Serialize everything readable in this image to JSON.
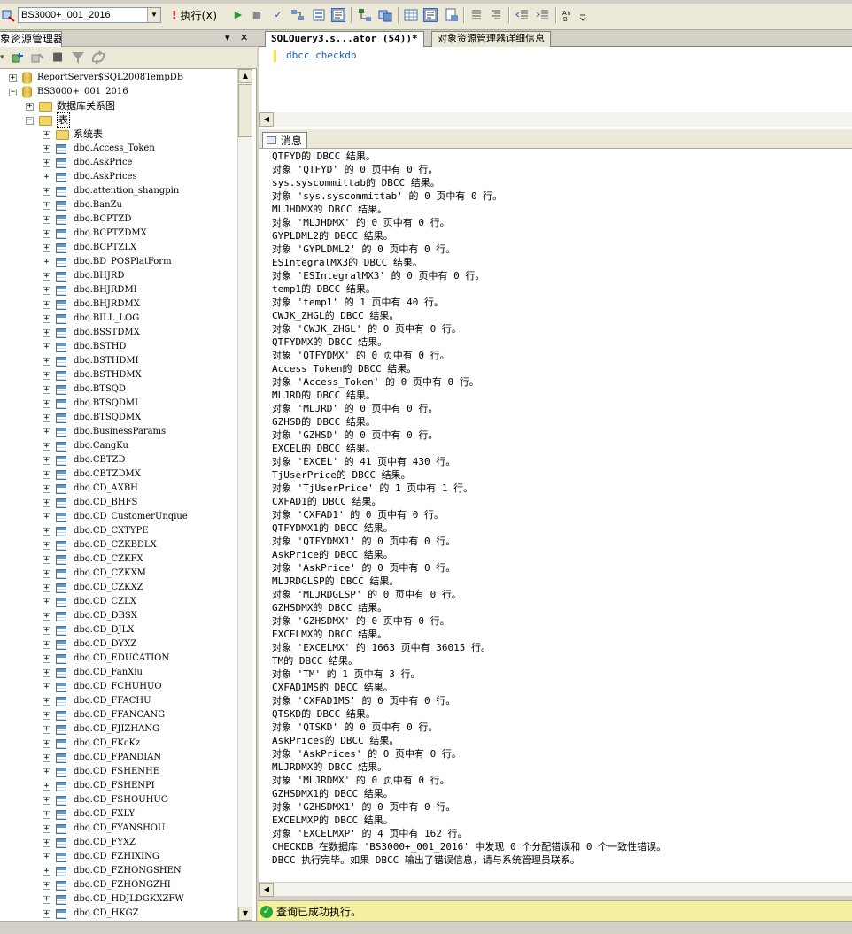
{
  "toolbar": {
    "database": "BS3000+_001_2016",
    "execute_label": "执行(X)"
  },
  "object_explorer": {
    "title": "象资源管理器",
    "pin": "▾",
    "close": "✕",
    "tree": {
      "server_db": "ReportServer$SQL2008TempDB",
      "db": "BS3000+_001_2016",
      "diagrams": "数据库关系图",
      "tables": "表",
      "system_tables": "系统表",
      "table_items": [
        "dbo.Access_Token",
        "dbo.AskPrice",
        "dbo.AskPrices",
        "dbo.attention_shangpin",
        "dbo.BanZu",
        "dbo.BCPTZD",
        "dbo.BCPTZDMX",
        "dbo.BCPTZLX",
        "dbo.BD_POSPlatForm",
        "dbo.BHJRD",
        "dbo.BHJRDMI",
        "dbo.BHJRDMX",
        "dbo.BILL_LOG",
        "dbo.BSSTDMX",
        "dbo.BSTHD",
        "dbo.BSTHDMI",
        "dbo.BSTHDMX",
        "dbo.BTSQD",
        "dbo.BTSQDMI",
        "dbo.BTSQDMX",
        "dbo.BusinessParams",
        "dbo.CangKu",
        "dbo.CBTZD",
        "dbo.CBTZDMX",
        "dbo.CD_AXBH",
        "dbo.CD_BHFS",
        "dbo.CD_CustomerUnqiue",
        "dbo.CD_CXTYPE",
        "dbo.CD_CZKBDLX",
        "dbo.CD_CZKFX",
        "dbo.CD_CZKXM",
        "dbo.CD_CZKXZ",
        "dbo.CD_CZLX",
        "dbo.CD_DBSX",
        "dbo.CD_DJLX",
        "dbo.CD_DYXZ",
        "dbo.CD_EDUCATION",
        "dbo.CD_FanXiu",
        "dbo.CD_FCHUHUO",
        "dbo.CD_FFACHU",
        "dbo.CD_FFANCANG",
        "dbo.CD_FJIZHANG",
        "dbo.CD_FKcKz",
        "dbo.CD_FPANDIAN",
        "dbo.CD_FSHENHE",
        "dbo.CD_FSHENPI",
        "dbo.CD_FSHOUHUO",
        "dbo.CD_FXLY",
        "dbo.CD_FYANSHOU",
        "dbo.CD_FYXZ",
        "dbo.CD_FZHIXING",
        "dbo.CD_FZHONGSHEN",
        "dbo.CD_FZHONGZHI",
        "dbo.CD_HDJLDGKXZFW",
        "dbo.CD_HKGZ"
      ]
    }
  },
  "tabs": {
    "query": "SQLQuery3.s...ator (54))*",
    "detail": "对象资源管理器详细信息"
  },
  "editor": {
    "code": "dbcc checkdb"
  },
  "results": {
    "tab": "消息",
    "lines": [
      "QTFYD的 DBCC 结果。",
      "对象 'QTFYD' 的 0 页中有 0 行。",
      "sys.syscommittab的 DBCC 结果。",
      "对象 'sys.syscommittab' 的 0 页中有 0 行。",
      "MLJHDMX的 DBCC 结果。",
      "对象 'MLJHDMX' 的 0 页中有 0 行。",
      "GYPLDML2的 DBCC 结果。",
      "对象 'GYPLDML2' 的 0 页中有 0 行。",
      "ESIntegralMX3的 DBCC 结果。",
      "对象 'ESIntegralMX3' 的 0 页中有 0 行。",
      "temp1的 DBCC 结果。",
      "对象 'temp1' 的 1 页中有 40 行。",
      "CWJK_ZHGL的 DBCC 结果。",
      "对象 'CWJK_ZHGL' 的 0 页中有 0 行。",
      "QTFYDMX的 DBCC 结果。",
      "对象 'QTFYDMX' 的 0 页中有 0 行。",
      "Access_Token的 DBCC 结果。",
      "对象 'Access_Token' 的 0 页中有 0 行。",
      "MLJRD的 DBCC 结果。",
      "对象 'MLJRD' 的 0 页中有 0 行。",
      "GZHSD的 DBCC 结果。",
      "对象 'GZHSD' 的 0 页中有 0 行。",
      "EXCEL的 DBCC 结果。",
      "对象 'EXCEL' 的 41 页中有 430 行。",
      "TjUserPrice的 DBCC 结果。",
      "对象 'TjUserPrice' 的 1 页中有 1 行。",
      "CXFAD1的 DBCC 结果。",
      "对象 'CXFAD1' 的 0 页中有 0 行。",
      "QTFYDMX1的 DBCC 结果。",
      "对象 'QTFYDMX1' 的 0 页中有 0 行。",
      "AskPrice的 DBCC 结果。",
      "对象 'AskPrice' 的 0 页中有 0 行。",
      "MLJRDGLSP的 DBCC 结果。",
      "对象 'MLJRDGLSP' 的 0 页中有 0 行。",
      "GZHSDMX的 DBCC 结果。",
      "对象 'GZHSDMX' 的 0 页中有 0 行。",
      "EXCELMX的 DBCC 结果。",
      "对象 'EXCELMX' 的 1663 页中有 36015 行。",
      "TM的 DBCC 结果。",
      "对象 'TM' 的 1 页中有 3 行。",
      "CXFAD1MS的 DBCC 结果。",
      "对象 'CXFAD1MS' 的 0 页中有 0 行。",
      "QTSKD的 DBCC 结果。",
      "对象 'QTSKD' 的 0 页中有 0 行。",
      "AskPrices的 DBCC 结果。",
      "对象 'AskPrices' 的 0 页中有 0 行。",
      "MLJRDMX的 DBCC 结果。",
      "对象 'MLJRDMX' 的 0 页中有 0 行。",
      "GZHSDMX1的 DBCC 结果。",
      "对象 'GZHSDMX1' 的 0 页中有 0 行。",
      "EXCELMXP的 DBCC 结果。",
      "对象 'EXCELMXP' 的 4 页中有 162 行。",
      "CHECKDB 在数据库 'BS3000+_001_2016' 中发现 0 个分配错误和 0 个一致性错误。",
      "DBCC 执行完毕。如果 DBCC 输出了错误信息，请与系统管理员联系。"
    ]
  },
  "status": {
    "message": "查询已成功执行。"
  },
  "colors": {
    "status_bar": "#f5f0a0",
    "code_keyword": "#1a5fb4",
    "success": "#2aa831"
  }
}
